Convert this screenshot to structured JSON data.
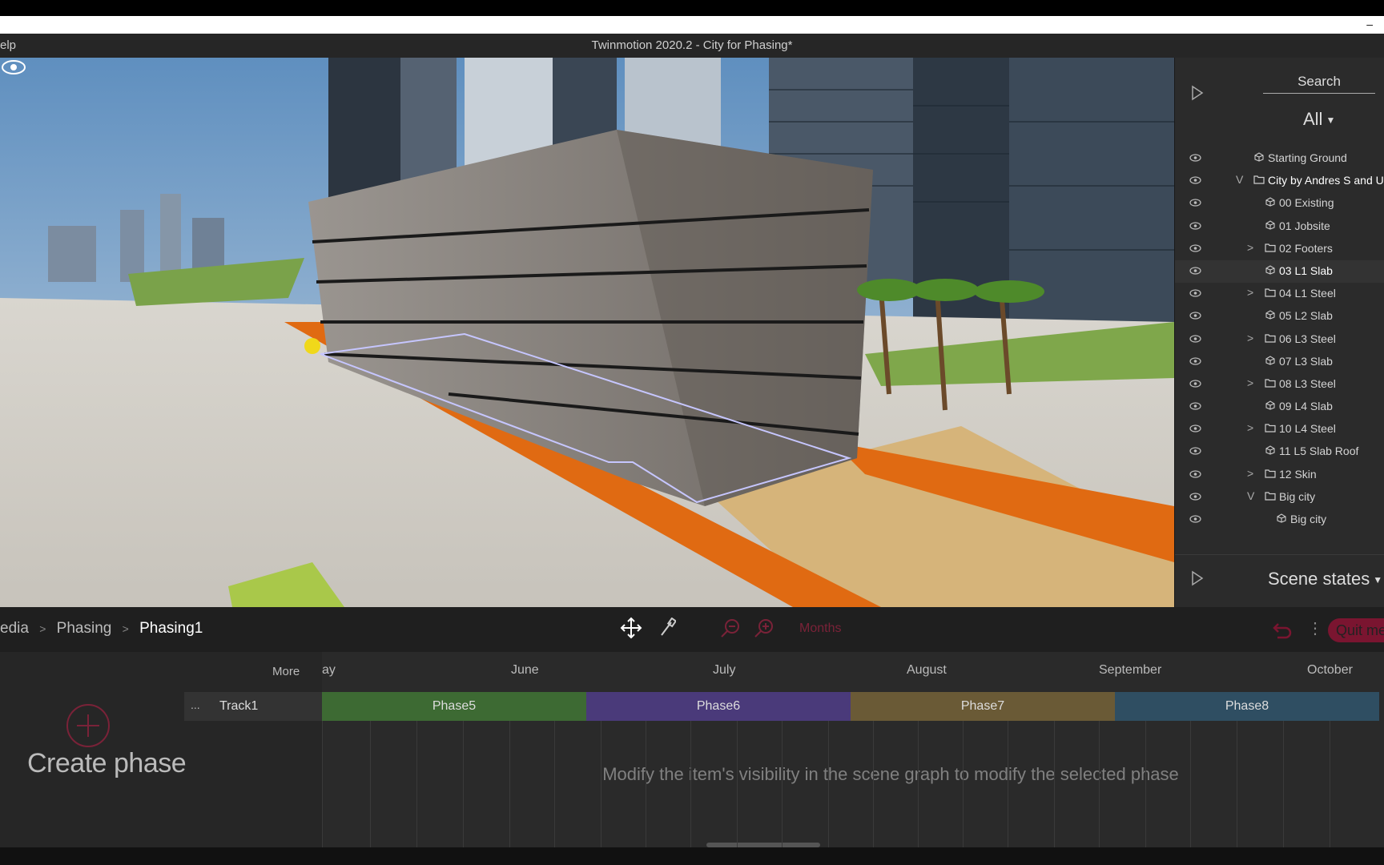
{
  "window": {
    "title": "Twinmotion 2020.2 - City for Phasing*",
    "menu_partial": "elp",
    "minimize": "–"
  },
  "scene_panel": {
    "search_label": "Search",
    "filter_label": "All",
    "items": [
      {
        "label": "Starting Ground",
        "expander": "",
        "icon": "mesh",
        "level": 0,
        "bright": false
      },
      {
        "label": "City by Andres S and Unforg",
        "expander": "V",
        "icon": "folder",
        "level": 0,
        "bright": true
      },
      {
        "label": "00 Existing",
        "expander": "",
        "icon": "mesh",
        "level": 1,
        "bright": false
      },
      {
        "label": "01 Jobsite",
        "expander": "",
        "icon": "mesh",
        "level": 1,
        "bright": false
      },
      {
        "label": "02 Footers",
        "expander": ">",
        "icon": "folder",
        "level": 1,
        "bright": false
      },
      {
        "label": "03 L1 Slab",
        "expander": "",
        "icon": "mesh",
        "level": 1,
        "bright": true,
        "selected": true
      },
      {
        "label": "04 L1 Steel",
        "expander": ">",
        "icon": "folder",
        "level": 1,
        "bright": false
      },
      {
        "label": "05 L2 Slab",
        "expander": "",
        "icon": "mesh",
        "level": 1,
        "bright": false
      },
      {
        "label": "06 L3 Steel",
        "expander": ">",
        "icon": "folder",
        "level": 1,
        "bright": false
      },
      {
        "label": "07 L3 Slab",
        "expander": "",
        "icon": "mesh",
        "level": 1,
        "bright": false
      },
      {
        "label": "08 L3 Steel",
        "expander": ">",
        "icon": "folder",
        "level": 1,
        "bright": false
      },
      {
        "label": "09 L4 Slab",
        "expander": "",
        "icon": "mesh",
        "level": 1,
        "bright": false
      },
      {
        "label": "10 L4 Steel",
        "expander": ">",
        "icon": "folder",
        "level": 1,
        "bright": false
      },
      {
        "label": "11 L5 Slab Roof",
        "expander": "",
        "icon": "mesh",
        "level": 1,
        "bright": false
      },
      {
        "label": "12 Skin",
        "expander": ">",
        "icon": "folder",
        "level": 1,
        "bright": false
      },
      {
        "label": "Big city",
        "expander": "V",
        "icon": "folder",
        "level": 1,
        "bright": false
      },
      {
        "label": "Big city",
        "expander": "",
        "icon": "mesh",
        "level": 2,
        "bright": false
      }
    ],
    "scene_states_label": "Scene states"
  },
  "toolbar": {
    "breadcrumb": [
      "edia",
      "Phasing",
      "Phasing1"
    ],
    "months_label": "Months",
    "quit_label": "Quit med",
    "icons": [
      "move-icon",
      "eyedropper-icon",
      "zoom-out-icon",
      "zoom-in-icon",
      "undo-icon"
    ]
  },
  "timeline": {
    "more_label": "More",
    "create_phase_label": "Create phase",
    "track_dots": "...",
    "track_name": "Track1",
    "months": [
      "ay",
      "June",
      "July",
      "August",
      "September",
      "October"
    ],
    "phases": [
      {
        "label": "Phase5",
        "color": "#3d6a33"
      },
      {
        "label": "Phase6",
        "color": "#4a3a7a"
      },
      {
        "label": "Phase7",
        "color": "#6a5a36"
      },
      {
        "label": "Phase8",
        "color": "#2f4e62"
      }
    ],
    "hint": "Modify the item's visibility in the scene graph to modify the selected phase"
  },
  "colors": {
    "accent_quit": "#7a1530",
    "months_text": "#7a2238"
  }
}
